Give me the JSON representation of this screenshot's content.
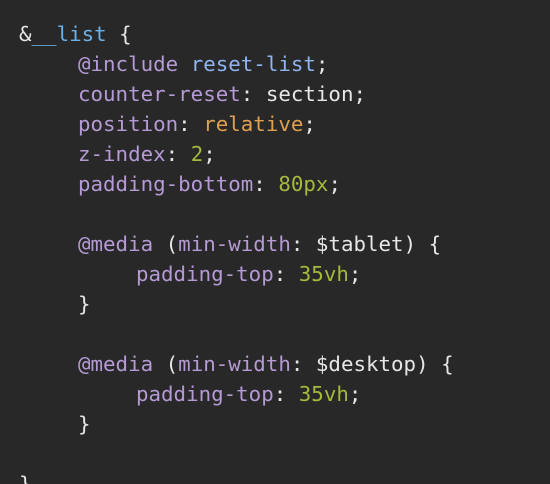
{
  "code": {
    "lines": [
      {
        "t": [
          {
            "c": "plain",
            "v": "&"
          },
          {
            "c": "selector",
            "v": "__list"
          },
          {
            "c": "punct",
            "v": " {"
          }
        ]
      },
      {
        "t": [
          {
            "c": "atrule",
            "v": "@include"
          },
          {
            "c": "plain",
            "v": " "
          },
          {
            "c": "mixin",
            "v": "reset-list"
          },
          {
            "c": "punct",
            "v": ";"
          }
        ]
      },
      {
        "t": [
          {
            "c": "prop",
            "v": "counter-reset"
          },
          {
            "c": "punct",
            "v": ": "
          },
          {
            "c": "value",
            "v": "section"
          },
          {
            "c": "punct",
            "v": ";"
          }
        ]
      },
      {
        "t": [
          {
            "c": "prop",
            "v": "position"
          },
          {
            "c": "punct",
            "v": ": "
          },
          {
            "c": "keyword",
            "v": "relative"
          },
          {
            "c": "punct",
            "v": ";"
          }
        ]
      },
      {
        "t": [
          {
            "c": "prop",
            "v": "z-index"
          },
          {
            "c": "punct",
            "v": ": "
          },
          {
            "c": "number",
            "v": "2"
          },
          {
            "c": "punct",
            "v": ";"
          }
        ]
      },
      {
        "t": [
          {
            "c": "prop",
            "v": "padding-bottom"
          },
          {
            "c": "punct",
            "v": ": "
          },
          {
            "c": "number",
            "v": "80px"
          },
          {
            "c": "punct",
            "v": ";"
          }
        ]
      },
      {
        "t": []
      },
      {
        "t": [
          {
            "c": "atrule",
            "v": "@media"
          },
          {
            "c": "plain",
            "v": " ("
          },
          {
            "c": "prop",
            "v": "min-width"
          },
          {
            "c": "punct",
            "v": ": "
          },
          {
            "c": "variable",
            "v": "$tablet"
          },
          {
            "c": "punct",
            "v": ") {"
          }
        ]
      },
      {
        "t": [
          {
            "c": "prop",
            "v": "padding-top"
          },
          {
            "c": "punct",
            "v": ": "
          },
          {
            "c": "number",
            "v": "35vh"
          },
          {
            "c": "punct",
            "v": ";"
          }
        ]
      },
      {
        "t": [
          {
            "c": "punct",
            "v": "}"
          }
        ]
      },
      {
        "t": []
      },
      {
        "t": [
          {
            "c": "atrule",
            "v": "@media"
          },
          {
            "c": "plain",
            "v": " ("
          },
          {
            "c": "prop",
            "v": "min-width"
          },
          {
            "c": "punct",
            "v": ": "
          },
          {
            "c": "variable",
            "v": "$desktop"
          },
          {
            "c": "punct",
            "v": ") {"
          }
        ]
      },
      {
        "t": [
          {
            "c": "prop",
            "v": "padding-top"
          },
          {
            "c": "punct",
            "v": ": "
          },
          {
            "c": "number",
            "v": "35vh"
          },
          {
            "c": "punct",
            "v": ";"
          }
        ]
      },
      {
        "t": [
          {
            "c": "punct",
            "v": "}"
          }
        ]
      },
      {
        "t": []
      },
      {
        "t": [
          {
            "c": "punct",
            "v": "}"
          }
        ]
      }
    ]
  }
}
